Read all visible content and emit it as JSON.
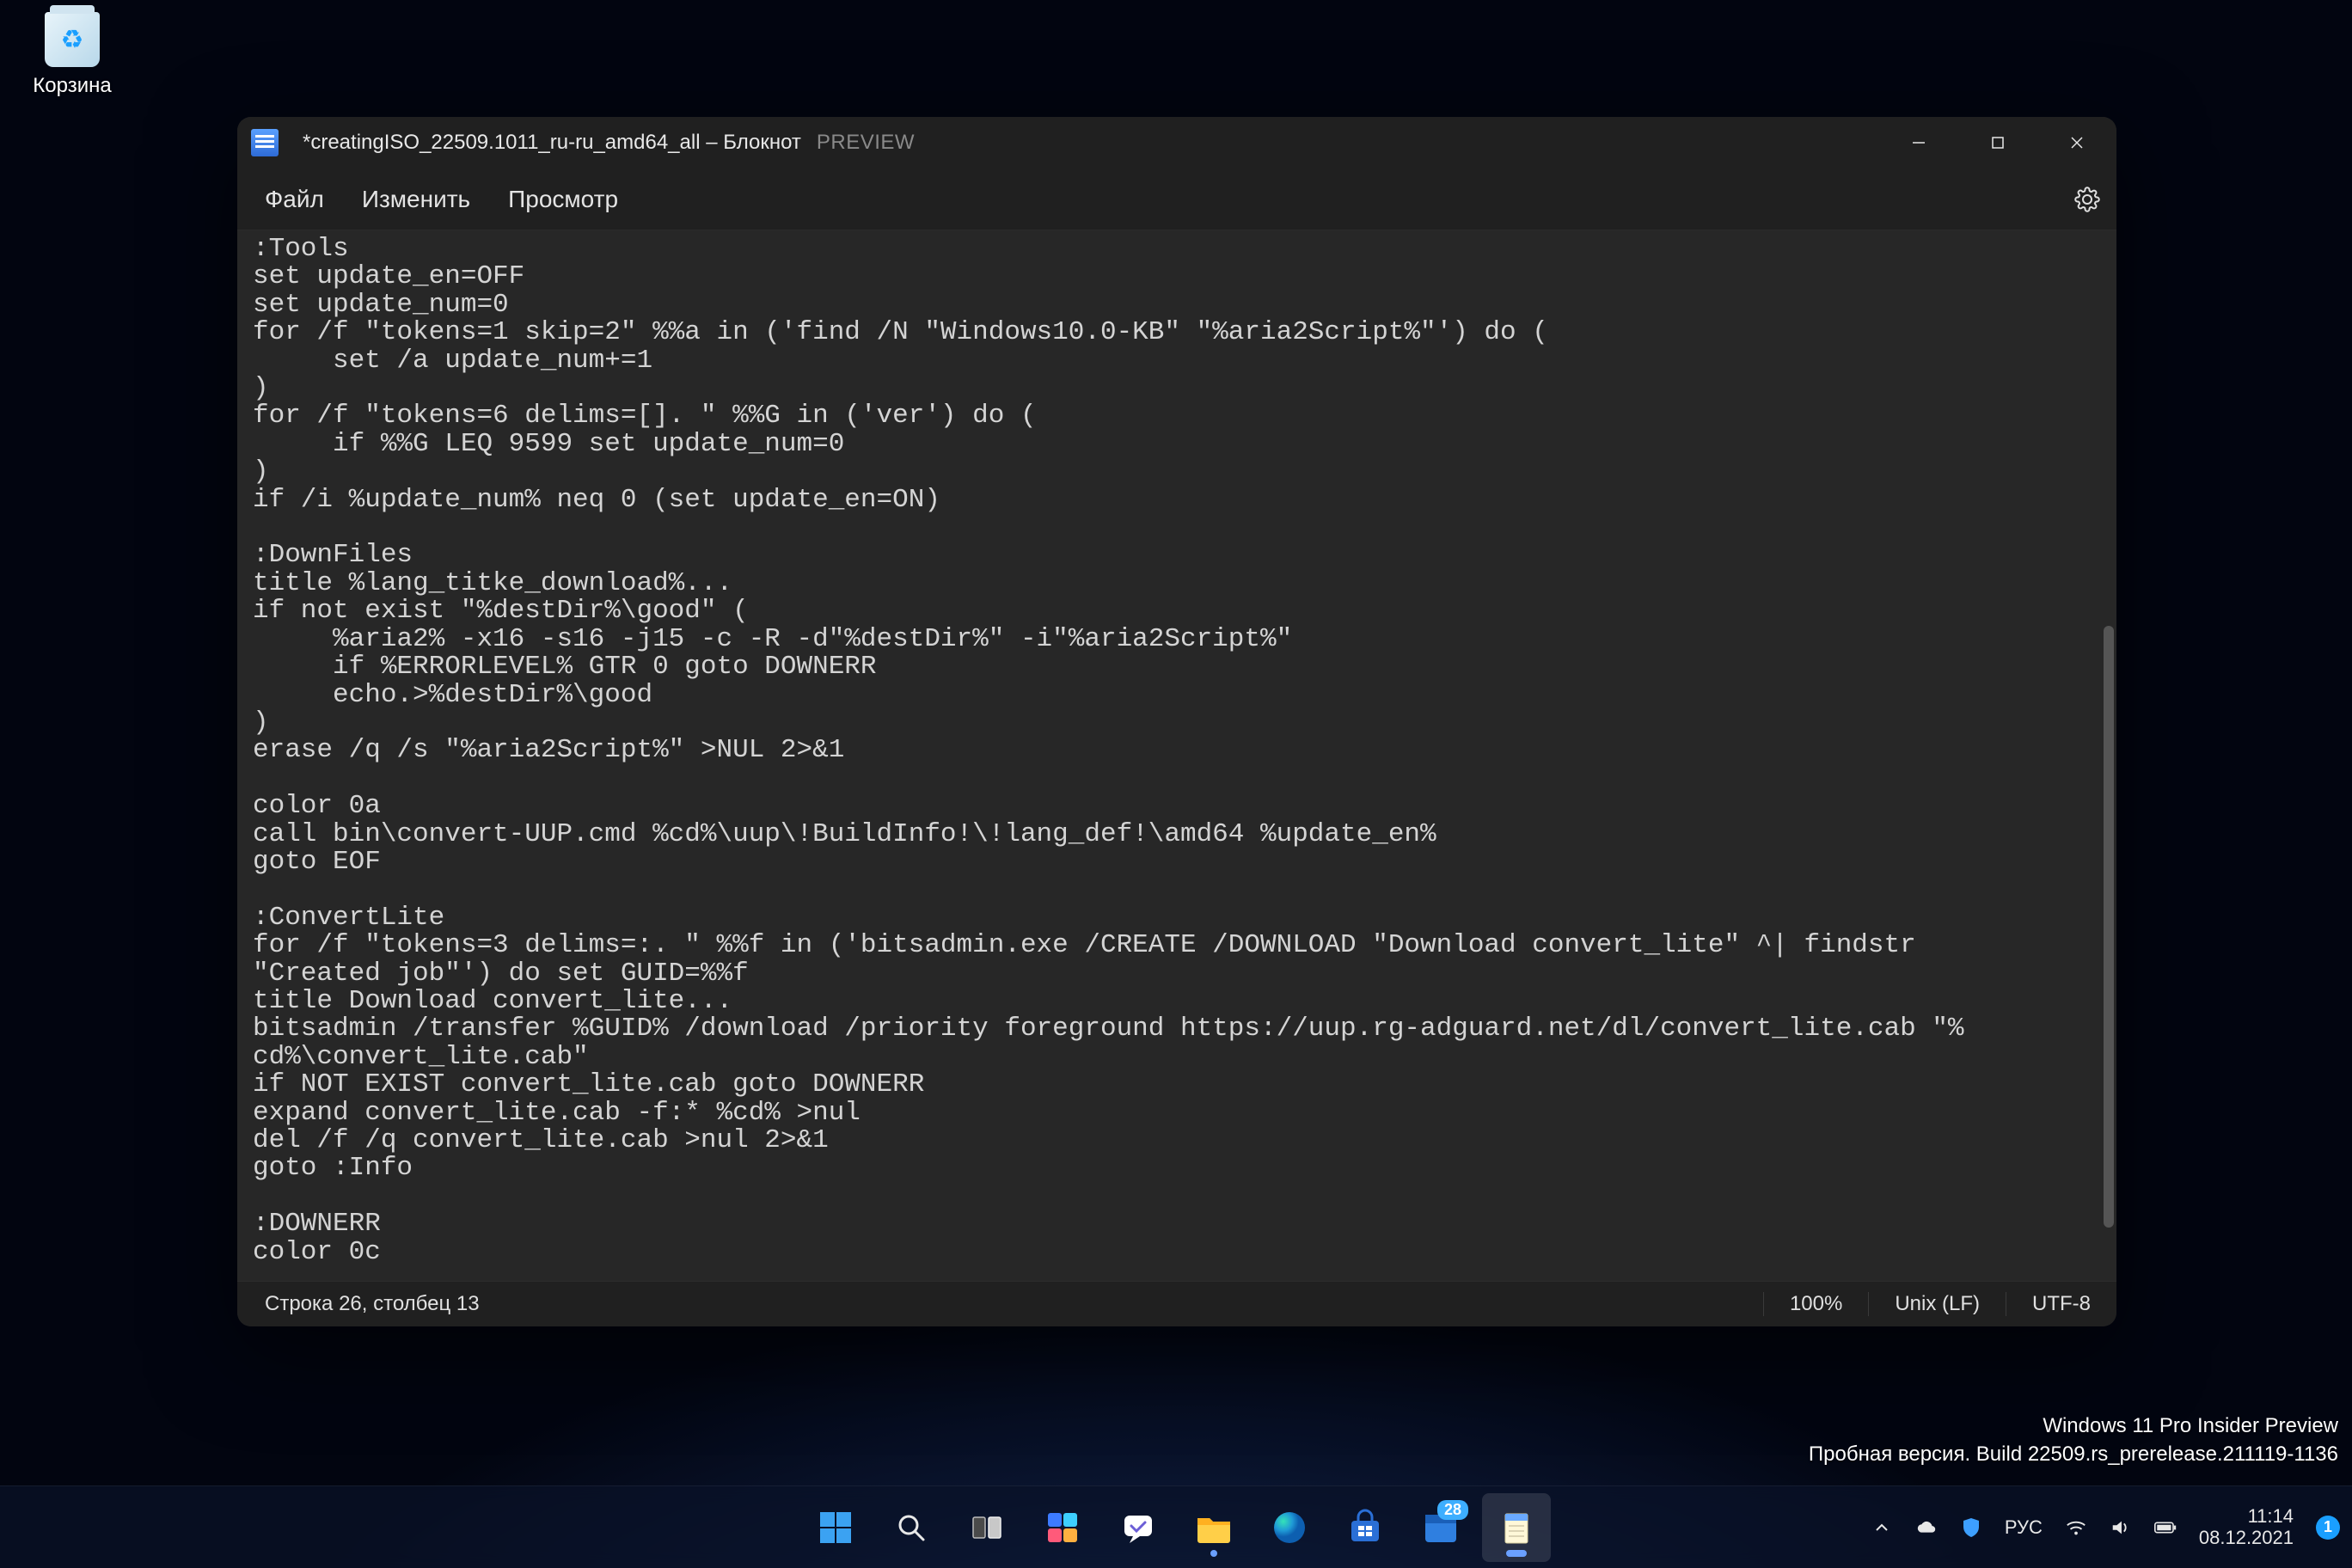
{
  "desktop": {
    "recycle_bin_label": "Корзина"
  },
  "watermark": {
    "line1": "Windows 11 Pro Insider Preview",
    "line2": "Пробная версия. Build 22509.rs_prerelease.211119-1136"
  },
  "window": {
    "title": "*creatingISO_22509.1011_ru-ru_amd64_all – Блокнот",
    "preview_badge": "PREVIEW",
    "menu": {
      "file": "Файл",
      "edit": "Изменить",
      "view": "Просмотр"
    },
    "status": {
      "cursor": "Строка 26, столбец 13",
      "zoom": "100%",
      "line_ending": "Unix (LF)",
      "encoding": "UTF-8"
    },
    "content": ":Tools\nset update_en=OFF\nset update_num=0\nfor /f \"tokens=1 skip=2\" %%a in ('find /N \"Windows10.0-KB\" \"%aria2Script%\"') do (\n     set /a update_num+=1\n)\nfor /f \"tokens=6 delims=[]. \" %%G in ('ver') do (\n     if %%G LEQ 9599 set update_num=0\n)\nif /i %update_num% neq 0 (set update_en=ON)\n\n:DownFiles\ntitle %lang_titke_download%...\nif not exist \"%destDir%\\good\" (\n     %aria2% -x16 -s16 -j15 -c -R -d\"%destDir%\" -i\"%aria2Script%\"\n     if %ERRORLEVEL% GTR 0 goto DOWNERR\n     echo.>%destDir%\\good\n)\nerase /q /s \"%aria2Script%\" >NUL 2>&1\n\ncolor 0a\ncall bin\\convert-UUP.cmd %cd%\\uup\\!BuildInfo!\\!lang_def!\\amd64 %update_en%\ngoto EOF\n\n:ConvertLite\nfor /f \"tokens=3 delims=:. \" %%f in ('bitsadmin.exe /CREATE /DOWNLOAD \"Download convert_lite\" ^| findstr \n\"Created job\"') do set GUID=%%f\ntitle Download convert_lite...\nbitsadmin /transfer %GUID% /download /priority foreground https://uup.rg-adguard.net/dl/convert_lite.cab \"%\ncd%\\convert_lite.cab\"\nif NOT EXIST convert_lite.cab goto DOWNERR\nexpand convert_lite.cab -f:* %cd% >nul\ndel /f /q convert_lite.cab >nul 2>&1\ngoto :Info\n\n:DOWNERR\ncolor 0c"
  },
  "taskbar": {
    "calendar_badge": "28"
  },
  "systray": {
    "language": "РУС",
    "time": "11:14",
    "date": "08.12.2021",
    "notif_count": "1"
  }
}
